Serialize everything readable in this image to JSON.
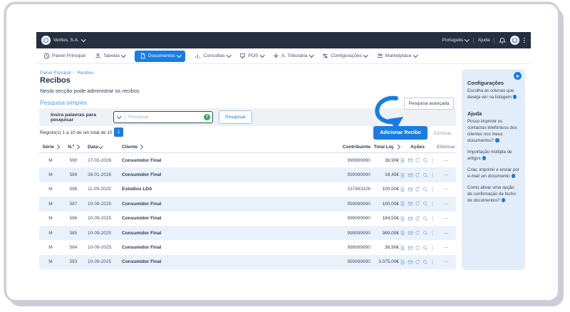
{
  "topbar": {
    "company": "Veritos, S.A.",
    "language": "Português",
    "help": "Ajuda"
  },
  "nav": {
    "items": [
      {
        "label": "Painel Principal",
        "icon": "clock-icon",
        "active": false
      },
      {
        "label": "Tabelas",
        "icon": "person-icon",
        "active": false
      },
      {
        "label": "Documentos",
        "icon": "document-icon",
        "active": true
      },
      {
        "label": "Consultas",
        "icon": "chart-icon",
        "active": false
      },
      {
        "label": "POS",
        "icon": "pos-icon",
        "active": false
      },
      {
        "label": "A. Tributária",
        "icon": "tax-icon",
        "active": false
      },
      {
        "label": "Configurações",
        "icon": "settings-icon",
        "active": false
      },
      {
        "label": "Marketplace",
        "icon": "marketplace-icon",
        "active": false
      }
    ]
  },
  "breadcrumb": {
    "items": [
      "Painel Principal",
      "Recibos"
    ],
    "separator": "/"
  },
  "page": {
    "title": "Recibos",
    "subtitle": "Nesta secção pode administrar os recibos"
  },
  "search": {
    "section_title": "Pesquisa simples",
    "label": "Insira palavras para pesquisar",
    "placeholder": "Pesquisar",
    "help_icon_text": "?",
    "search_button": "Pesquisar",
    "advanced_button": "Pesquisa avançada"
  },
  "results": {
    "info": "Registo(s) 1 a 10 de um total de 10",
    "current_page": "1",
    "add_button": "Adicionar Recibo",
    "delete_link": "Eliminar"
  },
  "table": {
    "headers": [
      {
        "label": "Série"
      },
      {
        "label": "N.º"
      },
      {
        "label": "Data"
      },
      {
        "label": "Cliente"
      },
      {
        "label": "Contribuinte"
      },
      {
        "label": "Total Líq."
      },
      {
        "label": "Ações"
      },
      {
        "label": "Eliminar"
      }
    ],
    "action_icons": [
      "document-icon",
      "email-icon",
      "refresh-icon",
      "magnifier-icon",
      "more-icon"
    ],
    "rows": [
      {
        "serie": "M",
        "num": "590",
        "date": "27-03-2026",
        "cliente": "Consumidor Final",
        "contribuinte": "999999990",
        "total": "36,90€",
        "eliminar": "—"
      },
      {
        "serie": "M",
        "num": "589",
        "date": "26-01-2026",
        "cliente": "Consumidor Final",
        "contribuinte": "999999990",
        "total": "18,45€",
        "eliminar": "—"
      },
      {
        "serie": "M",
        "num": "588",
        "date": "11-09-2025",
        "cliente": "Estúdios LDA",
        "contribuinte": "237463326",
        "total": "100,50€",
        "eliminar": "—"
      },
      {
        "serie": "M",
        "num": "587",
        "date": "10-09-2025",
        "cliente": "Consumidor Final",
        "contribuinte": "999999990",
        "total": "100,00€",
        "eliminar": "—"
      },
      {
        "serie": "M",
        "num": "586",
        "date": "10-09-2025",
        "cliente": "Consumidor Final",
        "contribuinte": "999999990",
        "total": "184,50€",
        "eliminar": "—"
      },
      {
        "serie": "M",
        "num": "585",
        "date": "10-09-2025",
        "cliente": "Consumidor Final",
        "contribuinte": "999999990",
        "total": "369,00€",
        "eliminar": "—"
      },
      {
        "serie": "M",
        "num": "584",
        "date": "10-09-2025",
        "cliente": "Consumidor Final",
        "contribuinte": "999999990",
        "total": "36,90€",
        "eliminar": "—"
      },
      {
        "serie": "M",
        "num": "583",
        "date": "10-09-2025",
        "cliente": "Consumidor Final",
        "contribuinte": "999999990",
        "total": "3.075,00€",
        "eliminar": "—"
      }
    ]
  },
  "sidebar": {
    "config_title": "Configurações",
    "config_text": "Escolha as colunas que deseja ver na listagem",
    "help_title": "Ajuda",
    "help_links": [
      "Posso imprimir os contactos telefónicos dos clientes nos meus documentos?",
      "Importação múltipla de artigos",
      "Criar, imprimir e enviar por e-mail um documento",
      "Como ativar uma opção de confirmação de fecho de documentos?"
    ]
  },
  "colors": {
    "accent": "#1a7ce2",
    "topbar_bg": "#242f40",
    "row_alt_bg": "#e9f2fb",
    "sidebar_bg": "#e3edfa",
    "help_green": "#27ae60"
  }
}
